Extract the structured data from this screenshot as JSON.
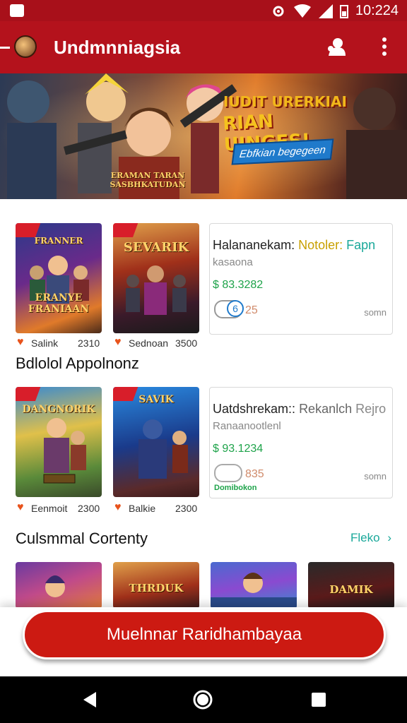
{
  "status_bar": {
    "time": "10:224",
    "icons": [
      "settings-icon",
      "wifi-icon",
      "signal-icon",
      "battery-icon"
    ]
  },
  "app_bar": {
    "title": "Undmnniagsia",
    "icons": [
      "user-icon",
      "more-vert-icon"
    ]
  },
  "banner": {
    "headline_line1": "IUDIT URERKIAI",
    "headline_line2": "RIAN UINGES!",
    "button_label": "Ebfkian begegeen",
    "character_caption_line1": "ERAMAN TARAN",
    "character_caption_line2": "SASBHKATUDAN"
  },
  "row1": {
    "cards": [
      {
        "thumb_title": "ERANYE FRANIAAN",
        "thumb_top": "FRANNER",
        "label": "Salink",
        "count": "2310"
      },
      {
        "thumb_title": "",
        "thumb_top": "SEVARIK",
        "label": "Sednoan",
        "count": "3500"
      }
    ],
    "detail": {
      "title_main": "Halananekam:",
      "title_accent1": "Notoler:",
      "title_accent2": "Fapn",
      "subtitle": "kasaona",
      "price": "$ 83.3282",
      "badge_num": "6",
      "count": "25",
      "right_text": "somn"
    }
  },
  "section1": {
    "title": "Bdlolol Appolnonz"
  },
  "row2": {
    "cards": [
      {
        "thumb_title": "",
        "thumb_top": "DANGNORIK",
        "label": "Eenmoit",
        "count": "2300"
      },
      {
        "thumb_title": "",
        "thumb_top": "SAVIK",
        "label": "Balkie",
        "count": "2300"
      }
    ],
    "detail": {
      "title_main": "Uatdshrekam::",
      "title_accent1": "Rekanlch",
      "title_accent2": "Rejro",
      "subtitle": "Ranaanootlenl",
      "price": "$ 93.1234",
      "count": "835",
      "right_text": "somn",
      "green_text": "Domibokon"
    }
  },
  "section2": {
    "title": "Culsmmal Cortenty",
    "see_all": "Fleko"
  },
  "small_thumbs": [
    {
      "label": ""
    },
    {
      "label": "THRDUK"
    },
    {
      "label": ""
    },
    {
      "label": "DAMIK"
    }
  ],
  "cta": {
    "label": "Muelnnar Raridhambayaa"
  },
  "nav_bar": {
    "icons": [
      "back-icon",
      "home-icon",
      "recents-icon"
    ]
  },
  "colors": {
    "primary": "#b4121c",
    "cta": "#cc1a12",
    "accent_teal": "#1aa89a",
    "price_green": "#1ea34a",
    "heart": "#e8531c"
  }
}
